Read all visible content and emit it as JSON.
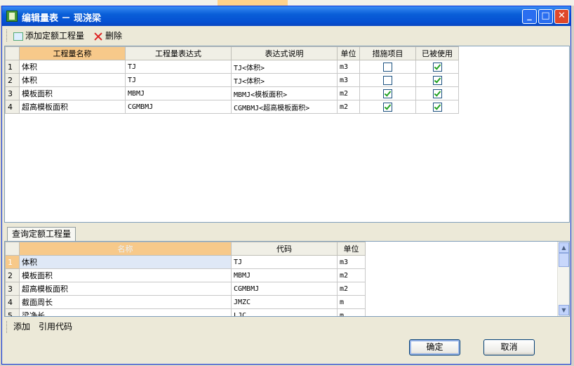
{
  "window": {
    "title": "编辑量表 － 现浇梁"
  },
  "toolbar": {
    "add_label": "添加定额工程量",
    "delete_label": "删除"
  },
  "top_table": {
    "headers": [
      "工程量名称",
      "工程量表达式",
      "表达式说明",
      "单位",
      "措施项目",
      "已被使用"
    ],
    "rows": [
      {
        "num": "1",
        "name": "体积",
        "expr": "TJ",
        "desc": "TJ<体积>",
        "unit": "m3",
        "measure": false,
        "used": true
      },
      {
        "num": "2",
        "name": "体积",
        "expr": "TJ",
        "desc": "TJ<体积>",
        "unit": "m3",
        "measure": false,
        "used": true
      },
      {
        "num": "3",
        "name": "模板面积",
        "expr": "MBMJ",
        "desc": "MBMJ<模板面积>",
        "unit": "m2",
        "measure": true,
        "used": true
      },
      {
        "num": "4",
        "name": "超高模板面积",
        "expr": "CGMBMJ",
        "desc": "CGMBMJ<超高模板面积>",
        "unit": "m2",
        "measure": true,
        "used": true
      }
    ]
  },
  "query_tab": {
    "label": "查询定额工程量"
  },
  "bottom_table": {
    "headers": [
      "名称",
      "代码",
      "单位"
    ],
    "rows": [
      {
        "num": "1",
        "name": "体积",
        "code": "TJ",
        "unit": "m3"
      },
      {
        "num": "2",
        "name": "模板面积",
        "code": "MBMJ",
        "unit": "m2"
      },
      {
        "num": "3",
        "name": "超高模板面积",
        "code": "CGMBMJ",
        "unit": "m2"
      },
      {
        "num": "4",
        "name": "截面周长",
        "code": "JMZC",
        "unit": "m"
      },
      {
        "num": "5",
        "name": "梁净长",
        "code": "LJC",
        "unit": "m"
      }
    ]
  },
  "bottom_bar": {
    "add_label": "添加",
    "ref_label": "引用代码"
  },
  "buttons": {
    "ok_label": "确定",
    "cancel_label": "取消"
  },
  "colors": {
    "title_bar": "#0a5fd8",
    "header_highlight": "#f7c98a",
    "check": "#21a121"
  },
  "icons": {
    "app": "app-icon",
    "add": "add-row-icon",
    "delete": "delete-icon"
  }
}
